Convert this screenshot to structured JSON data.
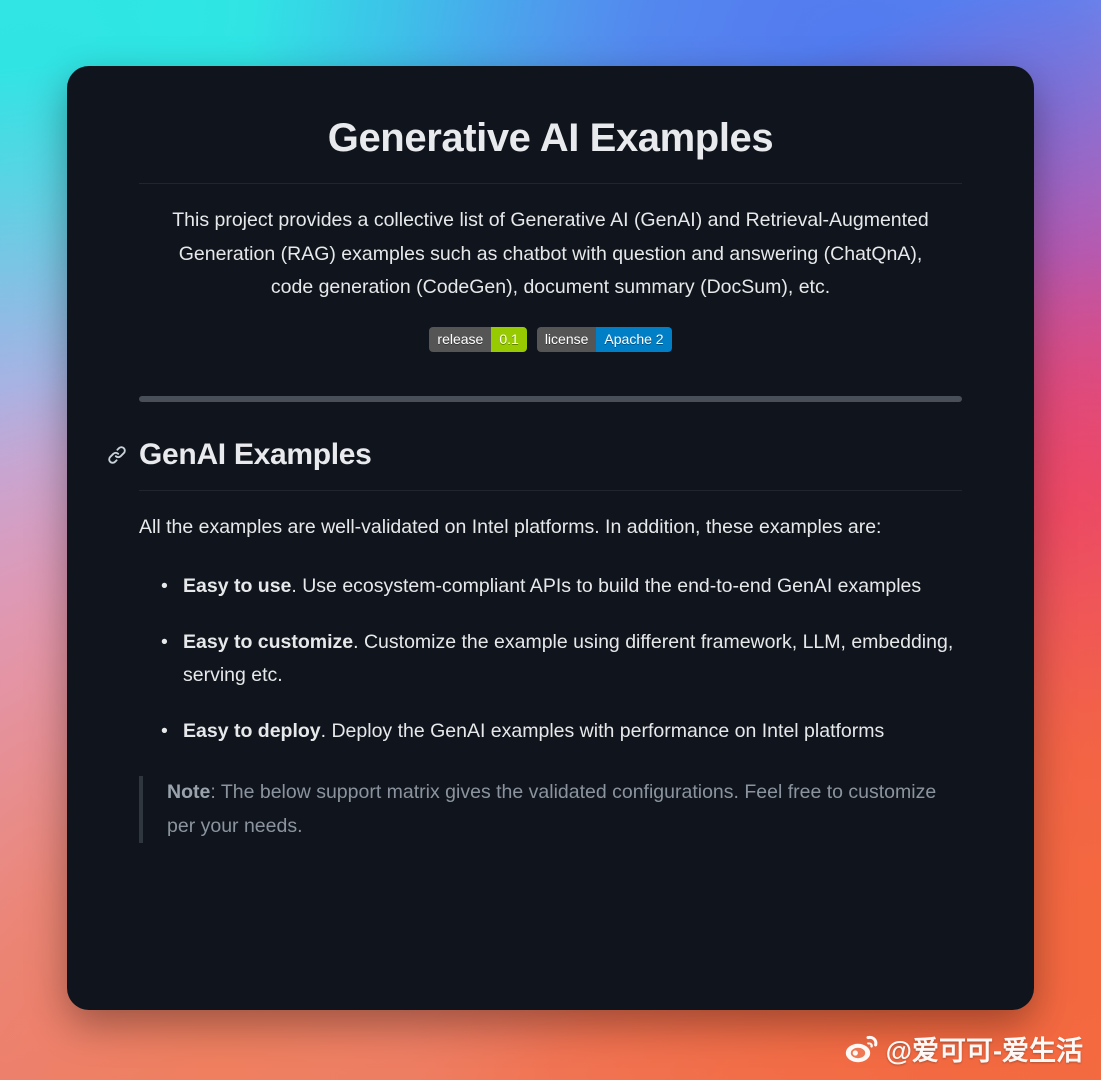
{
  "page": {
    "background_colors": {
      "cyan": "#3ee0e6",
      "blue": "#4f7bf0",
      "purple": "#a58fe0",
      "pink": "#e86f8e",
      "orange": "#ef6a52"
    },
    "card_background": "#10141c"
  },
  "document": {
    "title": "Generative AI Examples",
    "intro": "This project provides a collective list of Generative AI (GenAI) and Retrieval-Augmented Generation (RAG) examples such as chatbot with question and answering (ChatQnA), code generation (CodeGen), document summary (DocSum), etc.",
    "badges": [
      {
        "name": "release-badge",
        "label": "release",
        "value": "0.1",
        "label_color": "#555555",
        "value_color": "#97ca00"
      },
      {
        "name": "license-badge",
        "label": "license",
        "value": "Apache 2",
        "label_color": "#555555",
        "value_color": "#007ec6"
      }
    ],
    "section": {
      "anchor_icon": "link-icon",
      "heading": "GenAI Examples",
      "paragraph": "All the examples are well-validated on Intel platforms. In addition, these examples are:",
      "features": [
        {
          "strong": "Easy to use",
          "rest": ". Use ecosystem-compliant APIs to build the end-to-end GenAI examples"
        },
        {
          "strong": "Easy to customize",
          "rest": ". Customize the example using different framework, LLM, embedding, serving etc."
        },
        {
          "strong": "Easy to deploy",
          "rest": ". Deploy the GenAI examples with performance on Intel platforms"
        }
      ],
      "note": {
        "strong": "Note",
        "rest": ": The below support matrix gives the validated configurations. Feel free to customize per your needs."
      }
    }
  },
  "watermark": {
    "icon": "weibo-logo-icon",
    "handle": "@爱可可-爱生活"
  }
}
